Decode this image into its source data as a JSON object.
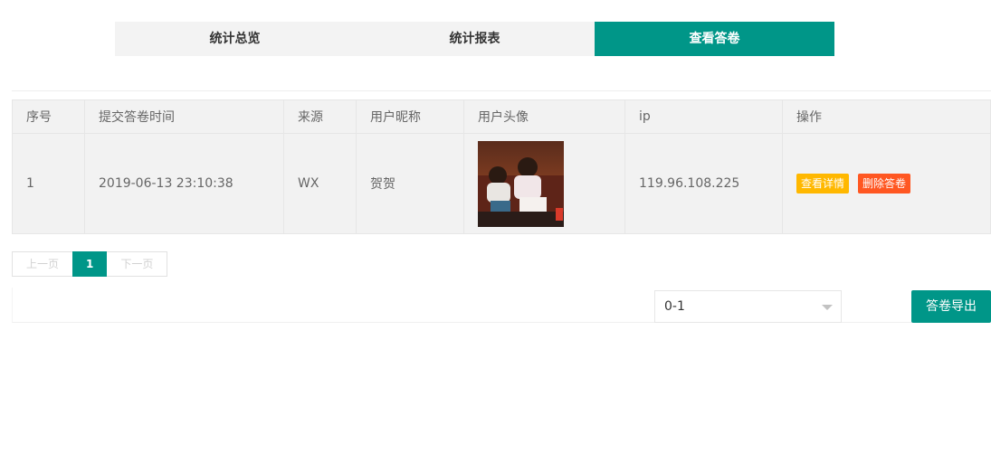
{
  "tabs": [
    {
      "label": "统计总览",
      "active": false
    },
    {
      "label": "统计报表",
      "active": false
    },
    {
      "label": "查看答卷",
      "active": true
    }
  ],
  "table": {
    "headers": [
      "序号",
      "提交答卷时间",
      "来源",
      "用户昵称",
      "用户头像",
      "ip",
      "操作"
    ],
    "rows": [
      {
        "index": "1",
        "submit_time": "2019-06-13 23:10:38",
        "source": "WX",
        "nickname": "贺贺",
        "ip": "119.96.108.225",
        "actions": {
          "view": "查看详情",
          "delete": "删除答卷"
        }
      }
    ]
  },
  "pager": {
    "prev": "上一页",
    "current": "1",
    "next": "下一页"
  },
  "export": {
    "range_value": "0-1",
    "button_label": "答卷导出"
  },
  "colors": {
    "accent": "#009688",
    "warn": "#ffb800",
    "danger": "#ff5722"
  }
}
